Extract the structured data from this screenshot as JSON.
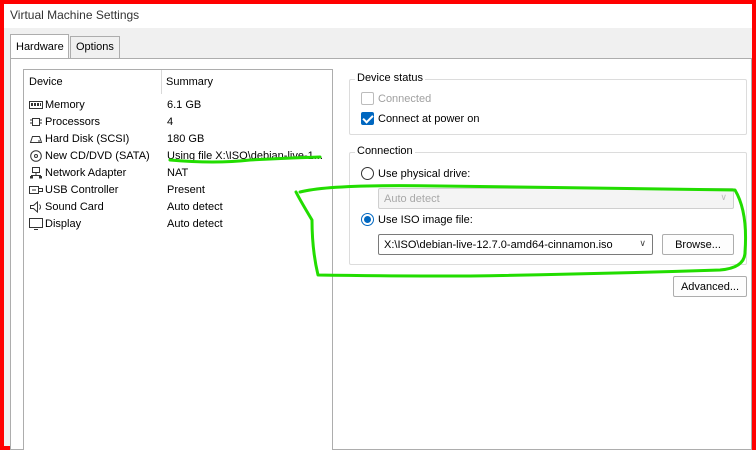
{
  "window": {
    "title": "Virtual Machine Settings"
  },
  "tabs": [
    {
      "label": "Hardware"
    },
    {
      "label": "Options"
    }
  ],
  "device_list": {
    "header": {
      "device": "Device",
      "summary": "Summary"
    },
    "rows": [
      {
        "name": "Memory",
        "summary": "6.1 GB",
        "icon": "memory-icon"
      },
      {
        "name": "Processors",
        "summary": "4",
        "icon": "processor-icon"
      },
      {
        "name": "Hard Disk (SCSI)",
        "summary": "180 GB",
        "icon": "hard-disk-icon"
      },
      {
        "name": "New CD/DVD (SATA)",
        "summary": "Using file X:\\ISO\\debian-live-1...",
        "icon": "cd-dvd-icon"
      },
      {
        "name": "Network Adapter",
        "summary": "NAT",
        "icon": "network-adapter-icon"
      },
      {
        "name": "USB Controller",
        "summary": "Present",
        "icon": "usb-controller-icon"
      },
      {
        "name": "Sound Card",
        "summary": "Auto detect",
        "icon": "sound-card-icon"
      },
      {
        "name": "Display",
        "summary": "Auto detect",
        "icon": "display-icon"
      }
    ]
  },
  "device_status": {
    "label": "Device status",
    "connected": {
      "label": "Connected",
      "checked": false,
      "disabled": true
    },
    "connect_at_power_on": {
      "label": "Connect at power on",
      "checked": true
    }
  },
  "connection": {
    "label": "Connection",
    "physical": {
      "label": "Use physical drive:",
      "selected": false,
      "drive_value": "Auto detect"
    },
    "iso": {
      "label": "Use ISO image file:",
      "selected": true,
      "file_value": "X:\\ISO\\debian-live-12.7.0-amd64-cinnamon.iso"
    },
    "browse_label": "Browse...",
    "advanced_label": "Advanced..."
  },
  "colors": {
    "accent": "#0067c0",
    "frame": "#ff0000",
    "annotation": "#22dd00"
  }
}
